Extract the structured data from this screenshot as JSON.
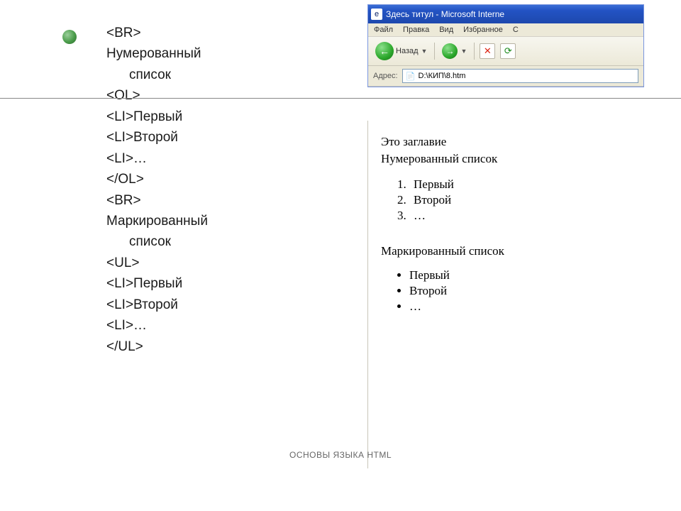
{
  "code": {
    "lines": [
      {
        "t": "<BR>",
        "i": false
      },
      {
        "t": "Нумерованный",
        "i": false
      },
      {
        "t": "список",
        "i": true
      },
      {
        "t": "<OL>",
        "i": false
      },
      {
        "t": "<LI>Первый",
        "i": false
      },
      {
        "t": "<LI>Второй",
        "i": false
      },
      {
        "t": "<LI>…",
        "i": false
      },
      {
        "t": "</OL>",
        "i": false
      },
      {
        "t": "<BR>",
        "i": false
      },
      {
        "t": "Маркированный",
        "i": false
      },
      {
        "t": "список",
        "i": true
      },
      {
        "t": "<UL>",
        "i": false
      },
      {
        "t": "<LI>Первый",
        "i": false
      },
      {
        "t": "<LI>Второй",
        "i": false
      },
      {
        "t": "<LI>…",
        "i": false
      },
      {
        "t": "</UL>",
        "i": false
      }
    ]
  },
  "browser": {
    "title": "Здесь титул - Microsoft Interne",
    "menus": [
      "Файл",
      "Правка",
      "Вид",
      "Избранное",
      "С"
    ],
    "back_label": "Назад",
    "addr_label": "Адрес:",
    "addr_value": "D:\\КИП\\8.htm"
  },
  "rendered": {
    "h1": "Это заглавие",
    "h2": "Нумерованный список",
    "ol": [
      "Первый",
      "Второй",
      "…"
    ],
    "h3": "Маркированный список",
    "ul": [
      "Первый",
      "Второй",
      "…"
    ]
  },
  "footer": "ОСНОВЫ ЯЗЫКА HTML"
}
